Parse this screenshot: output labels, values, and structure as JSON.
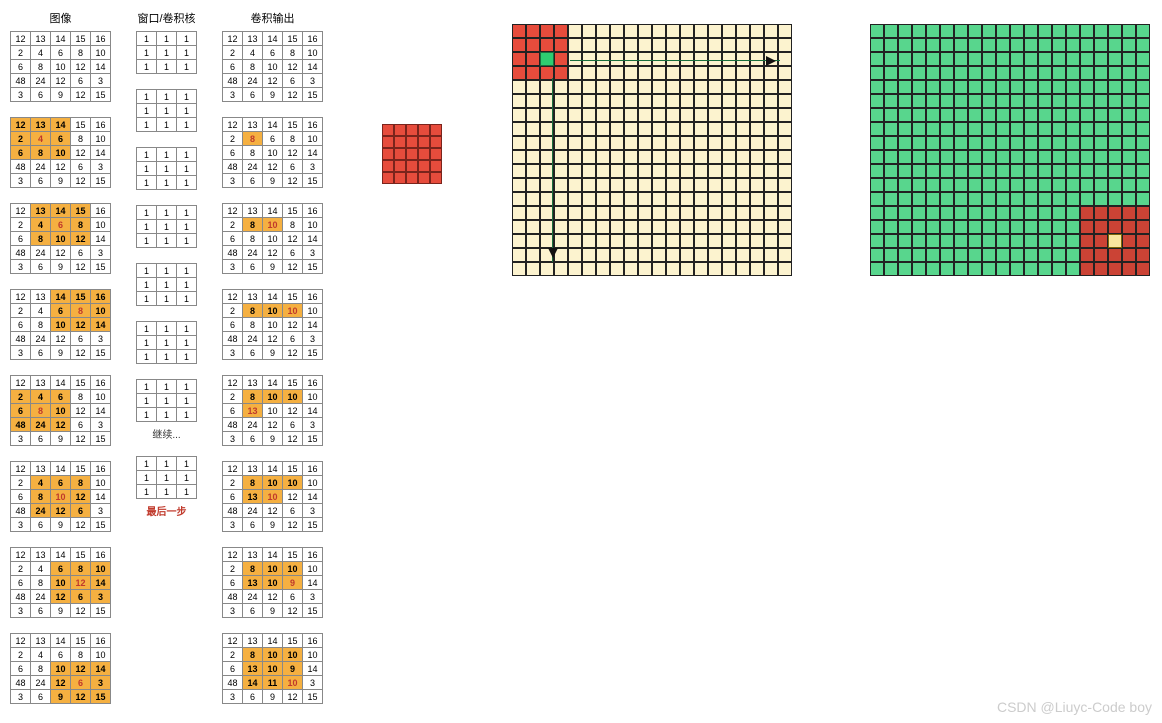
{
  "headers": {
    "image": "图像",
    "window": "窗口/卷积核",
    "output": "卷积输出"
  },
  "captions": {
    "continue": "继续...",
    "last": "最后一步"
  },
  "watermark": "CSDN @Liuyc-Code boy",
  "image_base": [
    [
      12,
      13,
      14,
      15,
      16
    ],
    [
      2,
      4,
      6,
      8,
      10
    ],
    [
      6,
      8,
      10,
      12,
      14
    ],
    [
      48,
      24,
      12,
      6,
      3
    ],
    [
      3,
      6,
      9,
      12,
      15
    ]
  ],
  "window": [
    [
      1,
      1,
      1
    ],
    [
      1,
      1,
      1
    ],
    [
      1,
      1,
      1
    ]
  ],
  "steps": [
    {
      "img_hl": [],
      "img_red": [],
      "out_hl": [],
      "out_red": [],
      "out": [
        [
          12,
          13,
          14,
          15,
          16
        ],
        [
          2,
          4,
          6,
          8,
          10
        ],
        [
          6,
          8,
          10,
          12,
          14
        ],
        [
          48,
          24,
          12,
          6,
          3
        ],
        [
          3,
          6,
          9,
          12,
          15
        ]
      ]
    },
    {
      "img_hl": [
        "0,0",
        "0,1",
        "0,2",
        "1,0",
        "1,1",
        "1,2",
        "2,0",
        "2,1",
        "2,2"
      ],
      "img_red": [
        "1,1"
      ],
      "out_hl": [
        "1,1"
      ],
      "out_red": [
        "1,1"
      ],
      "out": [
        [
          12,
          13,
          14,
          15,
          16
        ],
        [
          2,
          8,
          6,
          8,
          10
        ],
        [
          6,
          8,
          10,
          12,
          14
        ],
        [
          48,
          24,
          12,
          6,
          3
        ],
        [
          3,
          6,
          9,
          12,
          15
        ]
      ]
    },
    {
      "img_hl": [
        "0,1",
        "0,2",
        "0,3",
        "1,1",
        "1,2",
        "1,3",
        "2,1",
        "2,2",
        "2,3"
      ],
      "img_red": [
        "1,2"
      ],
      "out_hl": [
        "1,1",
        "1,2"
      ],
      "out_red": [
        "1,2"
      ],
      "out": [
        [
          12,
          13,
          14,
          15,
          16
        ],
        [
          2,
          8,
          10,
          8,
          10
        ],
        [
          6,
          8,
          10,
          12,
          14
        ],
        [
          48,
          24,
          12,
          6,
          3
        ],
        [
          3,
          6,
          9,
          12,
          15
        ]
      ]
    },
    {
      "img_hl": [
        "0,2",
        "0,3",
        "0,4",
        "1,2",
        "1,3",
        "1,4",
        "2,2",
        "2,3",
        "2,4"
      ],
      "img_red": [
        "1,3"
      ],
      "out_hl": [
        "1,1",
        "1,2",
        "1,3"
      ],
      "out_red": [
        "1,3"
      ],
      "out": [
        [
          12,
          13,
          14,
          15,
          16
        ],
        [
          2,
          8,
          10,
          10,
          10
        ],
        [
          6,
          8,
          10,
          12,
          14
        ],
        [
          48,
          24,
          12,
          6,
          3
        ],
        [
          3,
          6,
          9,
          12,
          15
        ]
      ]
    },
    {
      "img_hl": [
        "1,0",
        "1,1",
        "1,2",
        "2,0",
        "2,1",
        "2,2",
        "3,0",
        "3,1",
        "3,2"
      ],
      "img_red": [
        "2,1"
      ],
      "out_hl": [
        "1,1",
        "1,2",
        "1,3",
        "2,1"
      ],
      "out_red": [
        "2,1"
      ],
      "out": [
        [
          12,
          13,
          14,
          15,
          16
        ],
        [
          2,
          8,
          10,
          10,
          10
        ],
        [
          6,
          13,
          10,
          12,
          14
        ],
        [
          48,
          24,
          12,
          6,
          3
        ],
        [
          3,
          6,
          9,
          12,
          15
        ]
      ]
    },
    {
      "img_hl": [
        "1,1",
        "1,2",
        "1,3",
        "2,1",
        "2,2",
        "2,3",
        "3,1",
        "3,2",
        "3,3"
      ],
      "img_red": [
        "2,2"
      ],
      "out_hl": [
        "1,1",
        "1,2",
        "1,3",
        "2,1",
        "2,2"
      ],
      "out_red": [
        "2,2"
      ],
      "out": [
        [
          12,
          13,
          14,
          15,
          16
        ],
        [
          2,
          8,
          10,
          10,
          10
        ],
        [
          6,
          13,
          10,
          12,
          14
        ],
        [
          48,
          24,
          12,
          6,
          3
        ],
        [
          3,
          6,
          9,
          12,
          15
        ]
      ]
    },
    {
      "img_hl": [
        "1,2",
        "1,3",
        "1,4",
        "2,2",
        "2,3",
        "2,4",
        "3,2",
        "3,3",
        "3,4"
      ],
      "img_red": [
        "2,3"
      ],
      "out_hl": [
        "1,1",
        "1,2",
        "1,3",
        "2,1",
        "2,2",
        "2,3"
      ],
      "out_red": [
        "2,3"
      ],
      "out": [
        [
          12,
          13,
          14,
          15,
          16
        ],
        [
          2,
          8,
          10,
          10,
          10
        ],
        [
          6,
          13,
          10,
          9,
          14
        ],
        [
          48,
          24,
          12,
          6,
          3
        ],
        [
          3,
          6,
          9,
          12,
          15
        ]
      ]
    },
    {
      "img_hl": [
        "2,2",
        "2,3",
        "2,4",
        "3,2",
        "3,3",
        "3,4",
        "4,2",
        "4,3",
        "4,4"
      ],
      "img_red": [
        "3,3"
      ],
      "out_hl": [
        "1,1",
        "1,2",
        "1,3",
        "2,1",
        "2,2",
        "2,3",
        "3,1",
        "3,2",
        "3,3"
      ],
      "out_red": [
        "3,3"
      ],
      "out": [
        [
          12,
          13,
          14,
          15,
          16
        ],
        [
          2,
          8,
          10,
          10,
          10
        ],
        [
          6,
          13,
          10,
          9,
          14
        ],
        [
          48,
          14,
          11,
          10,
          3
        ],
        [
          3,
          6,
          9,
          12,
          15
        ]
      ]
    }
  ],
  "chart_data": {
    "type": "table",
    "description": "Convolution sliding-window illustration: 5x5 input, 3x3 ones kernel, stride 1",
    "input_image": [
      [
        12,
        13,
        14,
        15,
        16
      ],
      [
        2,
        4,
        6,
        8,
        10
      ],
      [
        6,
        8,
        10,
        12,
        14
      ],
      [
        48,
        24,
        12,
        6,
        3
      ],
      [
        3,
        6,
        9,
        12,
        15
      ]
    ],
    "kernel": [
      [
        1,
        1,
        1
      ],
      [
        1,
        1,
        1
      ],
      [
        1,
        1,
        1
      ]
    ],
    "final_output": [
      [
        12,
        13,
        14,
        15,
        16
      ],
      [
        2,
        8,
        10,
        10,
        10
      ],
      [
        6,
        13,
        10,
        9,
        14
      ],
      [
        48,
        14,
        11,
        10,
        3
      ],
      [
        3,
        6,
        9,
        12,
        15
      ]
    ]
  }
}
